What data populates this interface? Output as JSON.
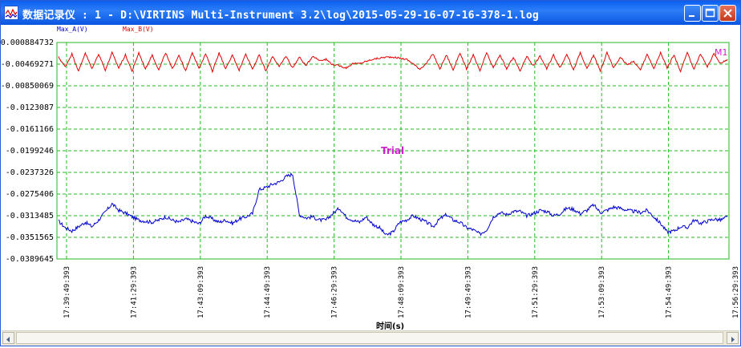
{
  "window": {
    "title": "数据记录仪 : 1 - D:\\VIRTINS Multi-Instrument 3.2\\log\\2015-05-29-16-07-16-378-1.log"
  },
  "chart_data": {
    "type": "line",
    "xlabel": "时间(s)",
    "watermark": "Trial",
    "marker_label": "M1",
    "y_ticks": [
      "0.000884732",
      "-0.00469271",
      "-0.00850069",
      "-0.0123087",
      "-0.0161166",
      "-0.0199246",
      "-0.0237326",
      "-0.0275406",
      "-0.0313485",
      "-0.0351565",
      "-0.0389645"
    ],
    "x_ticks": [
      "17:39:49:393",
      "17:41:29:393",
      "17:43:09:393",
      "17:44:49:393",
      "17:46:29:393",
      "17:48:09:393",
      "17:49:49:393",
      "17:51:29:393",
      "17:53:09:393",
      "17:54:49:393",
      "17:56:29:393"
    ],
    "ylim": [
      -0.0389645,
      0.000884732
    ],
    "grid": true,
    "legend_position": "top-left",
    "colors": {
      "Max_A": "#0000cc",
      "Max_B": "#dd0000",
      "grid": "#22bb22",
      "watermark": "#cc22cc"
    },
    "series": [
      {
        "name": "Max_A(V)",
        "x": [
          0,
          10,
          20,
          30,
          40,
          50,
          60,
          70,
          80,
          90,
          100,
          110,
          120,
          130,
          140,
          150,
          160,
          170,
          180,
          190,
          200,
          210,
          220,
          230,
          240,
          250,
          260,
          270,
          280,
          290,
          300,
          310,
          320,
          330,
          340,
          350,
          360,
          370,
          380,
          390,
          400,
          410,
          420,
          430,
          440,
          450,
          460,
          470,
          480,
          490,
          500,
          510,
          520,
          530,
          540,
          550,
          560,
          570,
          580,
          590,
          600,
          610,
          620,
          630,
          640,
          650,
          660,
          670,
          680,
          690,
          700,
          710,
          720,
          730,
          740,
          750,
          760,
          770,
          780,
          790,
          800,
          810,
          820,
          830,
          840,
          850,
          860,
          870,
          880,
          890,
          900,
          910,
          920,
          930,
          940,
          950,
          960,
          970,
          980,
          990,
          1000
        ],
        "values": [
          -0.032,
          -0.0332,
          -0.0338,
          -0.033,
          -0.0322,
          -0.033,
          -0.0318,
          -0.0303,
          -0.0288,
          -0.03,
          -0.0305,
          -0.0312,
          -0.0318,
          -0.032,
          -0.0322,
          -0.0318,
          -0.0312,
          -0.0318,
          -0.0322,
          -0.0316,
          -0.032,
          -0.0325,
          -0.031,
          -0.0316,
          -0.0322,
          -0.0318,
          -0.0324,
          -0.0316,
          -0.0312,
          -0.0306,
          -0.0262,
          -0.0258,
          -0.0252,
          -0.0248,
          -0.0238,
          -0.0233,
          -0.0308,
          -0.0314,
          -0.0312,
          -0.0318,
          -0.0318,
          -0.0306,
          -0.0296,
          -0.0312,
          -0.0318,
          -0.0322,
          -0.0312,
          -0.0326,
          -0.0332,
          -0.0346,
          -0.034,
          -0.0322,
          -0.0318,
          -0.031,
          -0.0316,
          -0.0322,
          -0.033,
          -0.0316,
          -0.0308,
          -0.0318,
          -0.0322,
          -0.0332,
          -0.0336,
          -0.0344,
          -0.0336,
          -0.0312,
          -0.0304,
          -0.0308,
          -0.0302,
          -0.0302,
          -0.031,
          -0.0306,
          -0.03,
          -0.0302,
          -0.031,
          -0.0306,
          -0.0296,
          -0.0298,
          -0.0306,
          -0.03,
          -0.029,
          -0.0304,
          -0.03,
          -0.0294,
          -0.0296,
          -0.03,
          -0.0302,
          -0.0304,
          -0.03,
          -0.0312,
          -0.0324,
          -0.034,
          -0.0338,
          -0.033,
          -0.0332,
          -0.0318,
          -0.0324,
          -0.032,
          -0.0316,
          -0.0318,
          -0.0312
        ]
      },
      {
        "name": "Max_B(V)",
        "x": [
          0,
          10,
          20,
          30,
          40,
          50,
          60,
          70,
          80,
          90,
          100,
          110,
          120,
          130,
          140,
          150,
          160,
          170,
          180,
          190,
          200,
          210,
          220,
          230,
          240,
          250,
          260,
          270,
          280,
          290,
          300,
          310,
          320,
          330,
          340,
          350,
          360,
          370,
          380,
          390,
          400,
          410,
          420,
          430,
          440,
          450,
          460,
          470,
          480,
          490,
          500,
          510,
          520,
          530,
          540,
          550,
          560,
          570,
          580,
          590,
          600,
          610,
          620,
          630,
          640,
          650,
          660,
          670,
          680,
          690,
          700,
          710,
          720,
          730,
          740,
          750,
          760,
          770,
          780,
          790,
          800,
          810,
          820,
          830,
          840,
          850,
          860,
          870,
          880,
          890,
          900,
          910,
          920,
          930,
          940,
          950,
          960,
          970,
          980,
          990,
          1000
        ],
        "values": [
          -0.0018,
          -0.0036,
          -0.0012,
          -0.0044,
          -0.001,
          -0.004,
          -0.0012,
          -0.0042,
          -0.001,
          -0.0038,
          -0.0014,
          -0.0044,
          -0.001,
          -0.004,
          -0.0014,
          -0.0042,
          -0.001,
          -0.004,
          -0.0014,
          -0.0044,
          -0.001,
          -0.0038,
          -0.0012,
          -0.0044,
          -0.001,
          -0.004,
          -0.0014,
          -0.0042,
          -0.0012,
          -0.004,
          -0.0014,
          -0.0044,
          -0.0016,
          -0.0036,
          -0.0016,
          -0.0038,
          -0.0018,
          -0.0034,
          -0.0016,
          -0.0024,
          -0.0022,
          -0.0032,
          -0.0034,
          -0.0038,
          -0.003,
          -0.003,
          -0.0026,
          -0.0022,
          -0.002,
          -0.0018,
          -0.0018,
          -0.002,
          -0.0022,
          -0.003,
          -0.004,
          -0.003,
          -0.0012,
          -0.004,
          -0.0014,
          -0.0042,
          -0.001,
          -0.004,
          -0.0014,
          -0.0044,
          -0.001,
          -0.0038,
          -0.0014,
          -0.004,
          -0.0018,
          -0.0044,
          -0.0016,
          -0.0034,
          -0.0016,
          -0.004,
          -0.0014,
          -0.0038,
          -0.0012,
          -0.0042,
          -0.001,
          -0.004,
          -0.0014,
          -0.0044,
          -0.001,
          -0.0038,
          -0.0018,
          -0.0032,
          -0.0026,
          -0.0042,
          -0.0012,
          -0.004,
          -0.001,
          -0.0038,
          -0.0014,
          -0.0044,
          -0.001,
          -0.004,
          -0.0012,
          -0.0036,
          -0.0012,
          -0.003,
          -0.0022
        ]
      }
    ]
  }
}
